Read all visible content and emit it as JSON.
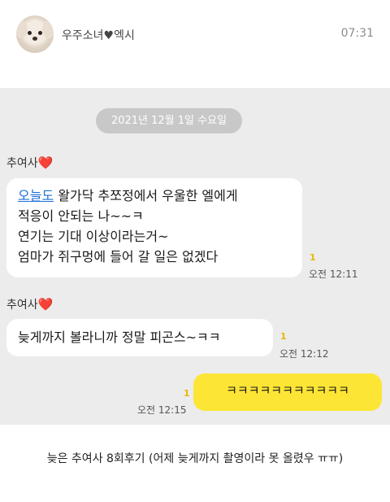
{
  "header": {
    "name": "우주소녀♥엑시",
    "time": "07:31"
  },
  "chat": {
    "date_divider": "2021년 12월 1일 수요일",
    "messages": [
      {
        "sender": "추여사",
        "heart": "❤️",
        "link_text": "오늘도",
        "lines": [
          " 왈가닥 추쪼정에서 우울한 엘에게",
          "적응이 안되는 나~~ㅋ",
          "연기는 기대 이상이라는거~",
          "엄마가 쥐구멍에 들어 갈 일은 없겠다"
        ],
        "unread": "1",
        "time": "오전 12:11"
      },
      {
        "sender": "추여사",
        "heart": "❤️",
        "lines": [
          "늦게까지 볼라니까 정말 피곤스~ㅋㅋ"
        ],
        "unread": "1",
        "time": "오전 12:12"
      },
      {
        "text": "ㅋㅋㅋㅋㅋㅋㅋㅋㅋㅋㅋ",
        "unread": "1",
        "time": "오전 12:15",
        "mine": true
      }
    ]
  },
  "caption": "늦은 추여사 8회후기 (어제 늦게까지 촬영이라 못 올렸우 ㅠㅠ)",
  "colors": {
    "my_bubble": "#fde535",
    "chat_background": "#ececec",
    "unread": "#e6b800"
  }
}
